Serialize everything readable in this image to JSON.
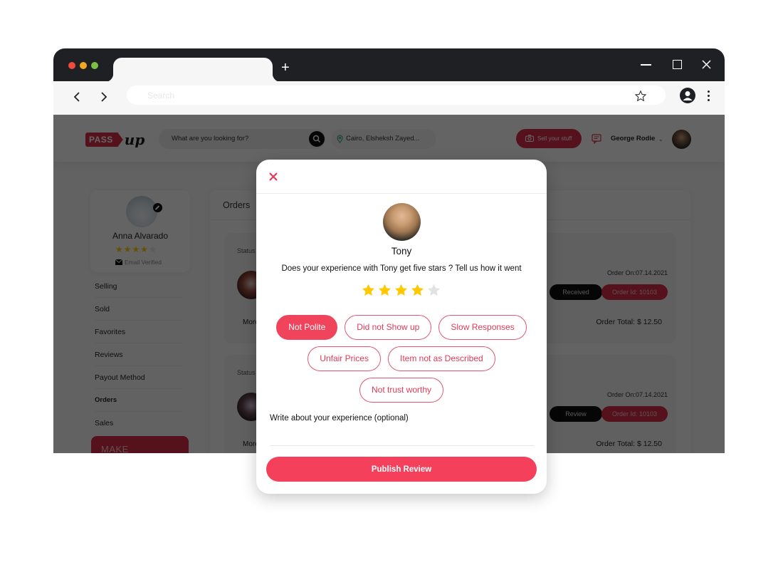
{
  "browser": {
    "omnibox_placeholder": "Search",
    "new_tab_label": "+",
    "window_controls": [
      "minimize-icon",
      "maximize-icon",
      "close-icon"
    ]
  },
  "site": {
    "logo": {
      "pass": "PASS",
      "up": "up"
    },
    "search_placeholder": "What are you looking for?",
    "location": "Cairo, Elsheksh Zayed...",
    "sell_button": "Sell your stuff",
    "user_name": "George Rodie",
    "accent_color": "#d62e46"
  },
  "sidebar": {
    "profile": {
      "name": "Anna Alvarado",
      "rating": 4,
      "max_rating": 5,
      "verification": "Email Verified"
    },
    "items": [
      {
        "label": "Selling"
      },
      {
        "label": "Sold"
      },
      {
        "label": "Favorites"
      },
      {
        "label": "Reviews"
      },
      {
        "label": "Payout Method"
      },
      {
        "label": "Orders"
      },
      {
        "label": "Sales"
      }
    ],
    "banner_text": "MAKE"
  },
  "orders": {
    "title": "Orders",
    "cards": [
      {
        "status_label": "Status",
        "more_label": "More",
        "date": "Order On:07.14.2021",
        "action": "Received",
        "order_id": "Order Id: 10103",
        "total": "Order Total: $ 12.50"
      },
      {
        "status_label": "Status",
        "more_label": "More",
        "date": "Order On:07.14.2021",
        "action": "Review",
        "order_id": "Order Id: 10103",
        "total": "Order Total: $ 12.50"
      }
    ]
  },
  "modal": {
    "reviewee_name": "Tony",
    "question": "Does your experience with Tony get five stars ? Tell us how it went",
    "rating": 4,
    "max_rating": 5,
    "star_color": "#ffc800",
    "star_empty_color": "#e2e2e2",
    "chips": [
      {
        "label": "Not Polite",
        "selected": true
      },
      {
        "label": "Did not Show up",
        "selected": false
      },
      {
        "label": "Slow Responses",
        "selected": false
      },
      {
        "label": "Unfair Prices",
        "selected": false
      },
      {
        "label": "Item not as Described",
        "selected": false
      },
      {
        "label": "Not trust worthy",
        "selected": false
      }
    ],
    "experience_label": "Write about your experience (optional)",
    "experience_value": "",
    "publish_button": "Publish Review",
    "primary_color": "#f4405a"
  }
}
